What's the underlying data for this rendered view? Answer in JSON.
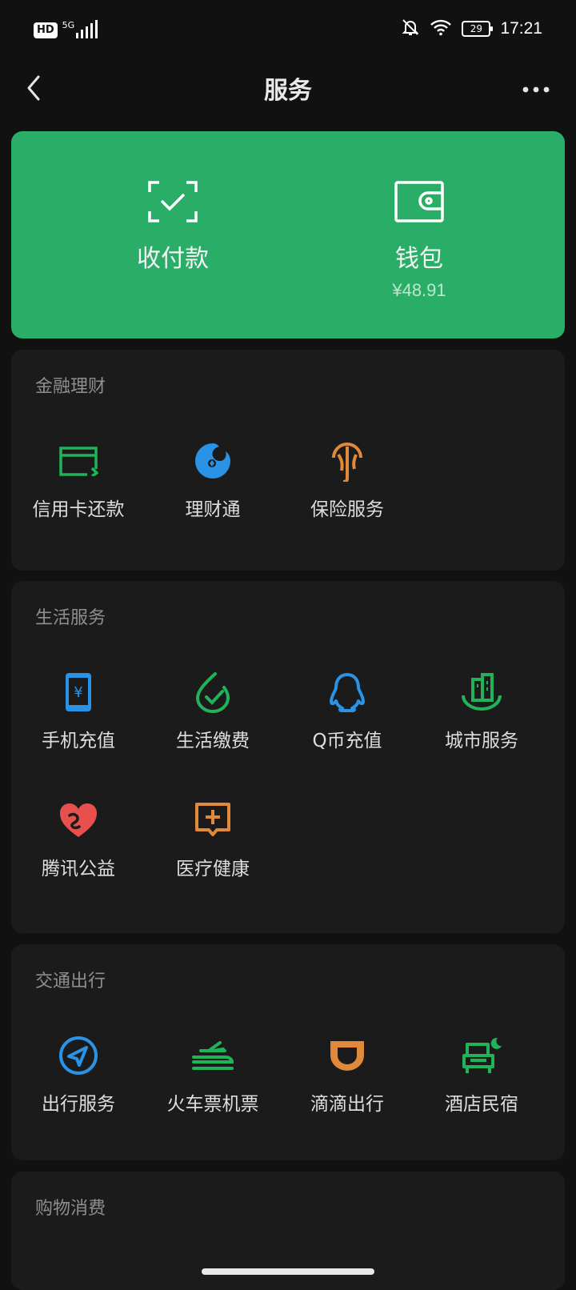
{
  "status_bar": {
    "hd": "HD",
    "network": "5G",
    "battery": "29",
    "time": "17:21"
  },
  "header": {
    "title": "服务"
  },
  "hero": {
    "pay": {
      "label": "收付款"
    },
    "wallet": {
      "label": "钱包",
      "amount": "¥48.91"
    }
  },
  "sections": {
    "finance": {
      "title": "金融理财",
      "items": [
        {
          "label": "信用卡还款",
          "icon": "credit-card-icon",
          "color": "#21b35a"
        },
        {
          "label": "理财通",
          "icon": "licaitong-icon",
          "color": "#2b93e6"
        },
        {
          "label": "保险服务",
          "icon": "insurance-icon",
          "color": "#e0893a"
        }
      ]
    },
    "life": {
      "title": "生活服务",
      "items": [
        {
          "label": "手机充值",
          "icon": "phone-recharge-icon",
          "color": "#2b93e6"
        },
        {
          "label": "生活缴费",
          "icon": "utility-payment-icon",
          "color": "#21b35a"
        },
        {
          "label": "Q币充值",
          "icon": "qq-coin-icon",
          "color": "#2b93e6"
        },
        {
          "label": "城市服务",
          "icon": "city-service-icon",
          "color": "#21b35a"
        },
        {
          "label": "腾讯公益",
          "icon": "charity-heart-icon",
          "color": "#e8504f"
        },
        {
          "label": "医疗健康",
          "icon": "medical-icon",
          "color": "#e0893a"
        }
      ]
    },
    "travel": {
      "title": "交通出行",
      "items": [
        {
          "label": "出行服务",
          "icon": "navigation-icon",
          "color": "#2b93e6"
        },
        {
          "label": "火车票机票",
          "icon": "train-plane-icon",
          "color": "#21b35a"
        },
        {
          "label": "滴滴出行",
          "icon": "didi-icon",
          "color": "#e0893a"
        },
        {
          "label": "酒店民宿",
          "icon": "hotel-bed-icon",
          "color": "#21b35a"
        }
      ]
    },
    "shopping": {
      "title": "购物消费"
    }
  }
}
